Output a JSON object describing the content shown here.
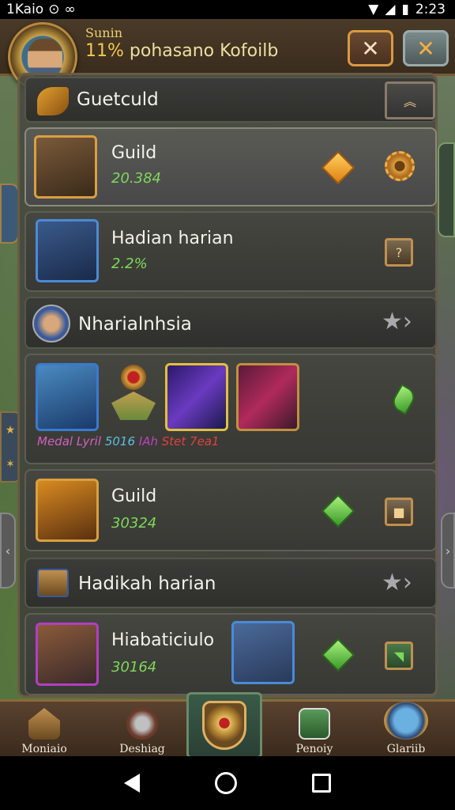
{
  "statusbar": {
    "left_text": "1Kaio",
    "time": "2:23"
  },
  "header": {
    "subtitle": "Sunin",
    "title_pct": "11%",
    "title_text": "pohasano Kofoilb",
    "close_label": "✕",
    "confirm_label": "✕"
  },
  "list": {
    "section1": {
      "title": "Guetculd"
    },
    "row1": {
      "title": "Guild",
      "value": "20.384"
    },
    "row2": {
      "title": "Hadian harian",
      "value": "2.2%"
    },
    "section2": {
      "title": "Nharialnhsia"
    },
    "items_row": {
      "caption_1": "Medal Lyril",
      "caption_2": "5016",
      "caption_3": "IAh",
      "caption_4": "Stet 7ea1"
    },
    "row3": {
      "title": "Guild",
      "value": "30324"
    },
    "section3": {
      "title": "Hadikah harian"
    },
    "row4": {
      "title": "Hiabaticiulo",
      "value": "30164"
    }
  },
  "bottom_nav": {
    "items": [
      {
        "label": "Moniaio"
      },
      {
        "label": "Deshiag"
      },
      {
        "label": "Penoiy"
      },
      {
        "label": "Glariib"
      }
    ]
  },
  "colors": {
    "value_green": "#7ed85a",
    "frame_gold": "#c9a050",
    "header_brown": "#4a3a28"
  }
}
